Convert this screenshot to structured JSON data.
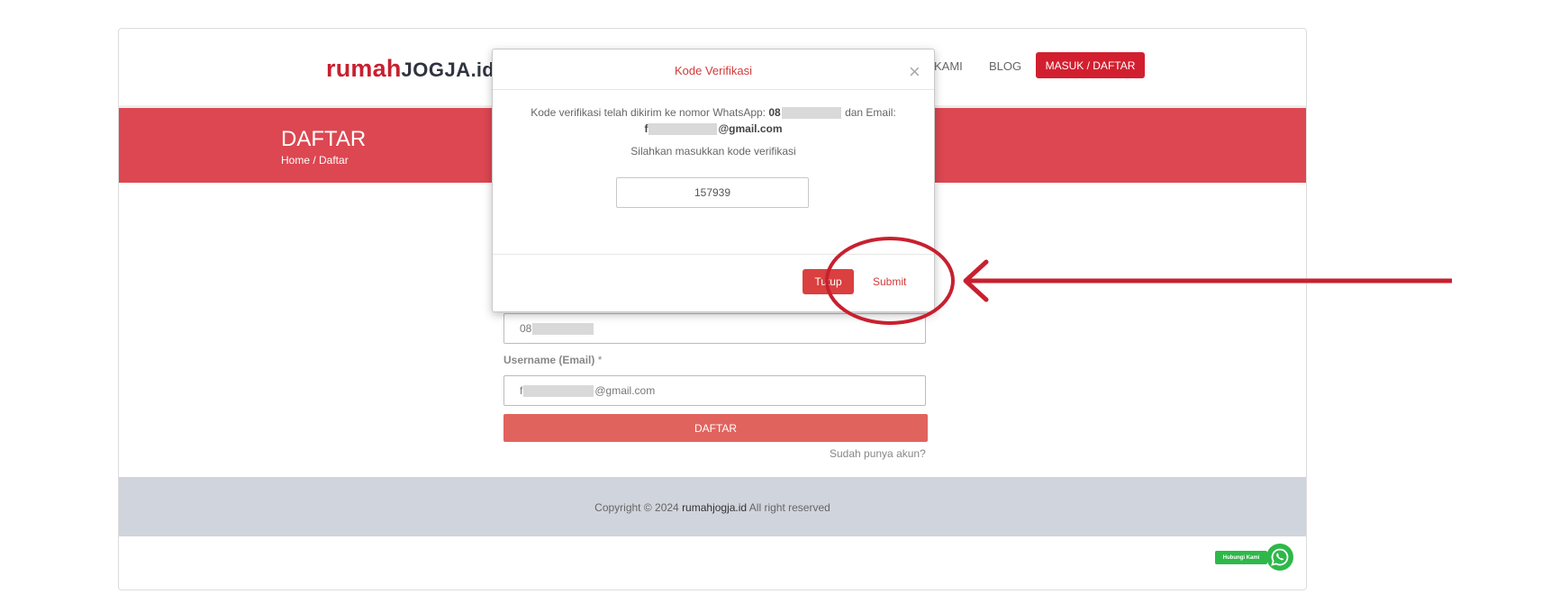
{
  "header": {
    "logo": {
      "part1": "rumah",
      "part2": "JOGJA",
      "part3": ".id"
    },
    "nav": {
      "partial_item": "KAMI",
      "blog": "BLOG",
      "cta": "MASUK / DAFTAR"
    }
  },
  "banner": {
    "title": "DAFTAR",
    "breadcrumb": "Home / Daftar"
  },
  "form": {
    "phone_prefix": "08",
    "username_label": "Username (Email)",
    "username_required_mark": "*",
    "email_prefix": "f",
    "email_suffix": "@gmail.com",
    "submit_label": "DAFTAR",
    "login_link": "Sudah punya akun?"
  },
  "footer": {
    "copyright_prefix": "Copyright © 2024",
    "brand": "rumahjogja.id",
    "copyright_suffix": "All right reserved"
  },
  "whatsapp": {
    "label": "Hubungi Kami",
    "icon": "whatsapp-icon"
  },
  "modal": {
    "title": "Kode Verifikasi",
    "close_glyph": "×",
    "msg_part1": "Kode verifikasi telah dikirim ke nomor WhatsApp:",
    "phone_prefix": "08",
    "msg_part2": "dan Email:",
    "email_prefix": "f",
    "email_suffix": "@gmail.com",
    "instruction": "Silahkan masukkan kode verifikasi",
    "code_value": "157939",
    "close_button": "Tutup",
    "submit_button": "Submit"
  },
  "colors": {
    "brand_red": "#d21f2f",
    "banner_red": "#dc4751",
    "footer_gray": "#d0d4dc",
    "annotation_red": "#c8202f",
    "whatsapp_green": "#2eb84a"
  }
}
